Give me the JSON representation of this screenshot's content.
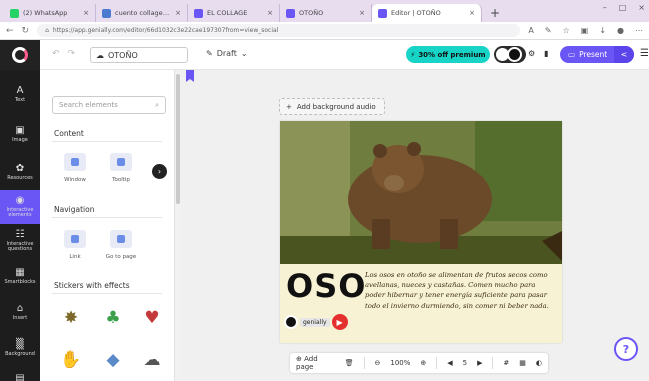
{
  "browser": {
    "tabs": [
      {
        "title": "(2) WhatsApp",
        "color": "#25d366"
      },
      {
        "title": "cuento collage en genially - B",
        "color": "#4a7bd1"
      },
      {
        "title": "EL COLLAGE",
        "color": "#6a55f5"
      },
      {
        "title": "OTOÑO",
        "color": "#6a55f5"
      },
      {
        "title": "Editor | OTOÑO",
        "color": "#6a55f5"
      }
    ],
    "url": "https://app.genially.com/editor/66d1032c3e22cae197307from=view_social",
    "window_controls": [
      "–",
      "□",
      "×"
    ]
  },
  "header": {
    "title": "OTOÑO",
    "status": "Draft",
    "premium_label": "30% off premium",
    "present_label": "Present"
  },
  "sidebar": {
    "items": [
      {
        "icon": "A",
        "label": "Text"
      },
      {
        "icon": "▣",
        "label": "Image"
      },
      {
        "icon": "✿",
        "label": "Resources"
      },
      {
        "icon": "◉",
        "label": "Interactive elements"
      },
      {
        "icon": "☷",
        "label": "Interactive questions"
      },
      {
        "icon": "▦",
        "label": "Smartblocks"
      },
      {
        "icon": "⌂",
        "label": "Insert"
      },
      {
        "icon": "▒",
        "label": "Background"
      },
      {
        "icon": "▤",
        "label": ""
      }
    ],
    "active_index": 3
  },
  "panel": {
    "search_placeholder": "Search elements",
    "sections": {
      "content": "Content",
      "navigation": "Navigation",
      "stickers": "Stickers with effects"
    },
    "content_items": [
      "Window",
      "Tooltip"
    ],
    "navigation_items": [
      "Link",
      "Go to page"
    ]
  },
  "canvas": {
    "background_audio": "Add background audio",
    "slide_title": "OSO",
    "slide_text": "Los osos en otoño se alimentan de frutos secos como avellanas, nueces y castañas. Comen mucho para poder hibernar y tener energía suficiente para pasar todo el invierno durmiendo, sin comer ni beber nada.",
    "badge_label": "genially"
  },
  "bottombar": {
    "add_page": "Add page",
    "zoom": "100%",
    "page": "5"
  },
  "help_label": "?"
}
